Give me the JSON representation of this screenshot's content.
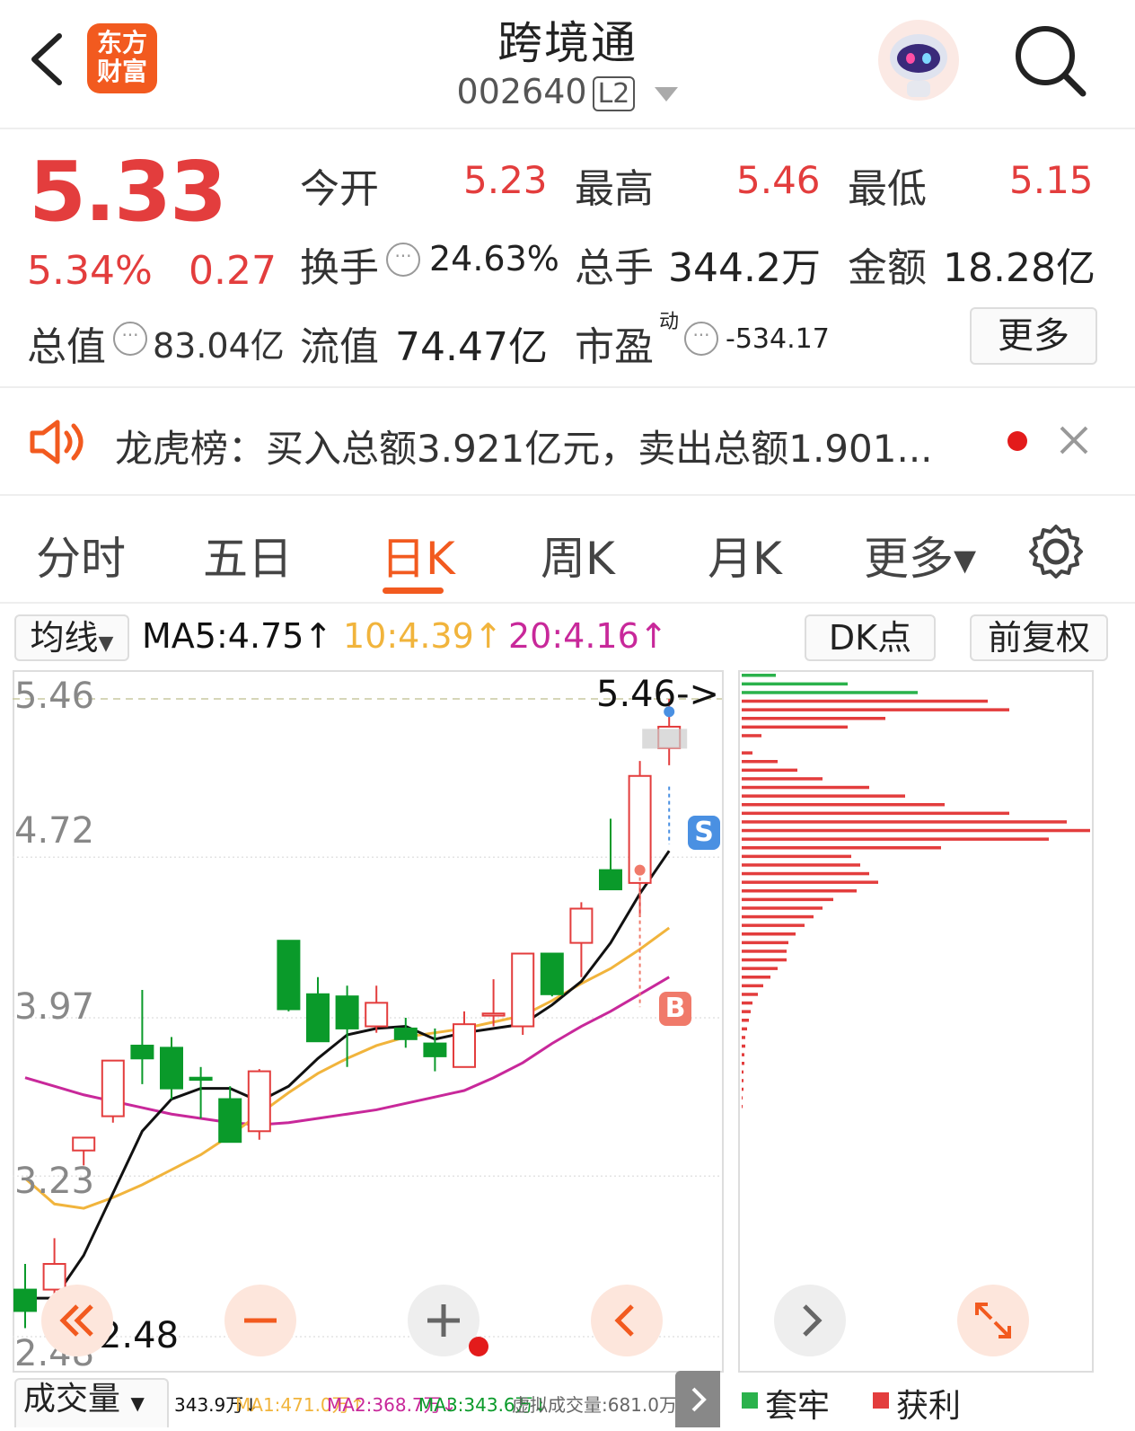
{
  "header": {
    "back_icon": "chevron-left-icon",
    "logo_line1": "东方",
    "logo_line2": "财富",
    "title": "跨境通",
    "code": "002640",
    "level_badge": "L2",
    "assistant_icon": "robot-avatar-icon",
    "search_icon": "search-icon"
  },
  "quote": {
    "price": "5.33",
    "change_pct": "5.34%",
    "change": "0.27",
    "open_label": "今开",
    "open": "5.23",
    "high_label": "最高",
    "high": "5.46",
    "low_label": "最低",
    "low": "5.15",
    "turnover_label": "换手",
    "turnover": "24.63%",
    "volume_label": "总手",
    "volume": "344.2万",
    "amount_label": "金额",
    "amount": "18.28亿",
    "mktcap_label": "总值",
    "mktcap": "83.04亿",
    "float_label": "流值",
    "float": "74.47亿",
    "pe_label": "市盈",
    "pe_sup": "动",
    "pe": "-534.17",
    "more_button": "更多"
  },
  "notice": {
    "icon": "speaker-icon",
    "text": "龙虎榜：买入总额3.921亿元，卖出总额1.901...",
    "close_icon": "close-icon"
  },
  "tabs": [
    {
      "label": "分时"
    },
    {
      "label": "五日"
    },
    {
      "label": "日K",
      "active": true
    },
    {
      "label": "周K"
    },
    {
      "label": "月K"
    },
    {
      "label": "更多▾"
    }
  ],
  "settings_icon": "gear-icon",
  "ma_bar": {
    "selector": "均线",
    "ma5": "MA5:4.75↑",
    "ma10": "10:4.39↑",
    "ma20": "20:4.16↑",
    "dk_button": "DK点",
    "fq_button": "前复权"
  },
  "colors": {
    "up": "#e33d3d",
    "down": "#0a9a2a",
    "ma5": "#111111",
    "ma10": "#f1b43c",
    "ma20": "#c8289a",
    "accent": "#f25a1f"
  },
  "chart_data": {
    "type": "candlestick",
    "y_ticks": [
      "5.46",
      "4.72",
      "3.97",
      "3.23",
      "2.48"
    ],
    "ylim": [
      2.48,
      5.46
    ],
    "high_marker": "5.46->",
    "low_marker": "<-2.48",
    "buy_marker": "B",
    "sell_marker": "S",
    "candles": [
      {
        "o": 2.7,
        "h": 2.82,
        "l": 2.52,
        "c": 2.6
      },
      {
        "o": 2.7,
        "h": 2.94,
        "l": 2.48,
        "c": 2.82
      },
      {
        "o": 3.35,
        "h": 3.41,
        "l": 3.28,
        "c": 3.41
      },
      {
        "o": 3.51,
        "h": 3.77,
        "l": 3.48,
        "c": 3.77
      },
      {
        "o": 3.84,
        "h": 4.1,
        "l": 3.66,
        "c": 3.78
      },
      {
        "o": 3.83,
        "h": 3.88,
        "l": 3.59,
        "c": 3.64
      },
      {
        "o": 3.69,
        "h": 3.74,
        "l": 3.5,
        "c": 3.68
      },
      {
        "o": 3.59,
        "h": 3.65,
        "l": 3.39,
        "c": 3.39
      },
      {
        "o": 3.44,
        "h": 3.73,
        "l": 3.4,
        "c": 3.72
      },
      {
        "o": 4.33,
        "h": 4.33,
        "l": 4.0,
        "c": 4.01
      },
      {
        "o": 4.08,
        "h": 4.16,
        "l": 3.86,
        "c": 3.86
      },
      {
        "o": 4.07,
        "h": 4.12,
        "l": 3.74,
        "c": 3.92
      },
      {
        "o": 3.93,
        "h": 4.12,
        "l": 3.9,
        "c": 4.04
      },
      {
        "o": 3.92,
        "h": 3.97,
        "l": 3.83,
        "c": 3.87
      },
      {
        "o": 3.85,
        "h": 3.92,
        "l": 3.72,
        "c": 3.79
      },
      {
        "o": 3.74,
        "h": 4.0,
        "l": 3.74,
        "c": 3.94
      },
      {
        "o": 3.98,
        "h": 4.15,
        "l": 3.93,
        "c": 3.99
      },
      {
        "o": 3.93,
        "h": 4.27,
        "l": 3.89,
        "c": 4.27
      },
      {
        "o": 4.27,
        "h": 4.27,
        "l": 4.07,
        "c": 4.08
      },
      {
        "o": 4.32,
        "h": 4.51,
        "l": 4.16,
        "c": 4.48
      },
      {
        "o": 4.66,
        "h": 4.9,
        "l": 4.58,
        "c": 4.57
      },
      {
        "o": 4.6,
        "h": 5.17,
        "l": 4.44,
        "c": 5.1
      },
      {
        "o": 5.23,
        "h": 5.46,
        "l": 5.15,
        "c": 5.33
      }
    ],
    "ma5": [
      2.66,
      2.66,
      2.86,
      3.15,
      3.44,
      3.59,
      3.64,
      3.64,
      3.58,
      3.65,
      3.78,
      3.89,
      3.92,
      3.93,
      3.87,
      3.9,
      3.92,
      3.94,
      4.03,
      4.14,
      4.32,
      4.55,
      4.75
    ],
    "ma10": [
      3.22,
      3.1,
      3.08,
      3.13,
      3.19,
      3.26,
      3.33,
      3.42,
      3.52,
      3.62,
      3.71,
      3.78,
      3.84,
      3.88,
      3.9,
      3.92,
      3.95,
      3.98,
      4.05,
      4.13,
      4.2,
      4.29,
      4.39
    ],
    "ma20": [
      3.69,
      3.65,
      3.61,
      3.58,
      3.55,
      3.52,
      3.5,
      3.48,
      3.47,
      3.48,
      3.5,
      3.52,
      3.54,
      3.57,
      3.6,
      3.63,
      3.69,
      3.76,
      3.85,
      3.93,
      4.0,
      4.08,
      4.16
    ]
  },
  "side_profile": {
    "legend_trap": "套牢",
    "legend_profit": "获利"
  },
  "controls": {
    "rewind_icon": "double-chevron-left-icon",
    "minus_icon": "minus-icon",
    "plus_icon": "plus-icon",
    "prev_icon": "chevron-left-icon",
    "next_icon": "chevron-right-icon",
    "expand_icon": "expand-icon"
  },
  "volume_bar": {
    "selector": "成交量",
    "vol": "343.9万↓",
    "ma1": "MA1:471.0万↑",
    "ma2": "MA2:368.7万↓",
    "ma3": "MA3:343.6万↓",
    "virtual": "虚拟成交量:681.0万"
  }
}
